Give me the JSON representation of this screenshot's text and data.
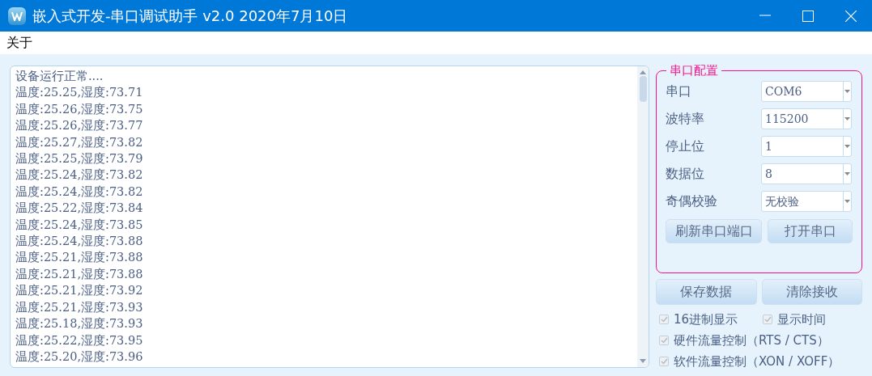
{
  "window": {
    "title": "嵌入式开发-串口调试助手 v2.0 2020年7月10日"
  },
  "menu": [
    "关于"
  ],
  "receive_log": {
    "lines": [
      "设备运行正常....",
      "温度:25.25,湿度:73.71",
      "温度:25.26,湿度:73.75",
      "温度:25.26,湿度:73.77",
      "温度:25.27,湿度:73.82",
      "温度:25.25,湿度:73.79",
      "温度:25.24,湿度:73.82",
      "温度:25.24,湿度:73.82",
      "温度:25.22,湿度:73.84",
      "温度:25.24,湿度:73.85",
      "温度:25.24,湿度:73.88",
      "温度:25.21,湿度:73.88",
      "温度:25.21,湿度:73.88",
      "温度:25.21,湿度:73.92",
      "温度:25.21,湿度:73.93",
      "温度:25.18,湿度:73.93",
      "温度:25.22,湿度:73.95",
      "温度:25.20,湿度:73.96"
    ]
  },
  "serial_config": {
    "title": "串口配置",
    "fields": [
      {
        "label": "串口",
        "value": "COM6"
      },
      {
        "label": "波特率",
        "value": "115200"
      },
      {
        "label": "停止位",
        "value": "1"
      },
      {
        "label": "数据位",
        "value": "8"
      },
      {
        "label": "奇偶校验",
        "value": "无校验"
      }
    ],
    "buttons": [
      "刷新串口端口",
      "打开串口"
    ]
  },
  "buttons": [
    "保存数据",
    "清除接收"
  ],
  "options": [
    {
      "label": "16进制显示",
      "checked": true,
      "disabled": true
    },
    {
      "label": "显示时间",
      "checked": true,
      "disabled": true
    },
    {
      "label": "硬件流量控制（RTS / CTS）",
      "checked": true,
      "disabled": true
    },
    {
      "label": "软件流量控制（XON / XOFF）",
      "checked": true,
      "disabled": true
    }
  ]
}
